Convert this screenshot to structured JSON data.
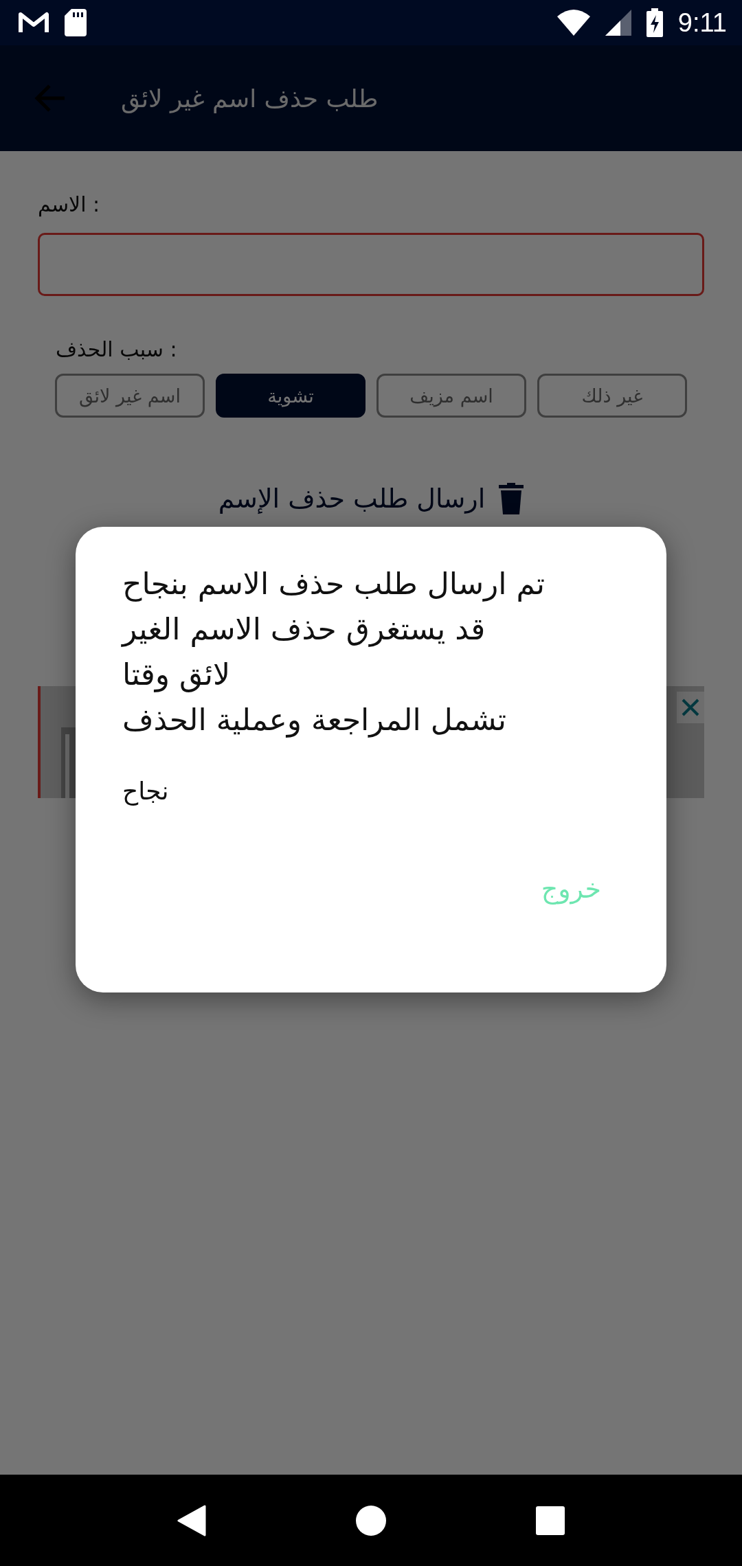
{
  "status_bar": {
    "time": "9:11"
  },
  "app_bar": {
    "title": "طلب حذف اسم غير لائق"
  },
  "name_field": {
    "label": "الاسم :",
    "error": true
  },
  "reason": {
    "label": "سبب الحذف :",
    "options": [
      {
        "label": "غير ذلك",
        "selected": false
      },
      {
        "label": "اسم مزيف",
        "selected": false
      },
      {
        "label": "تشوية",
        "selected": true
      },
      {
        "label": "اسم غير لائق",
        "selected": false
      }
    ]
  },
  "submit_button": {
    "label": "ارسال طلب حذف الإسم"
  },
  "dialog": {
    "message_lines": [
      "تم ارسال طلب حذف الاسم بنجاح",
      " قد يستغرق حذف الاسم الغير",
      "لائق وقتا",
      "تشمل المراجعة وعملية الحذف"
    ],
    "title": "نجاح",
    "button": "خروج"
  }
}
